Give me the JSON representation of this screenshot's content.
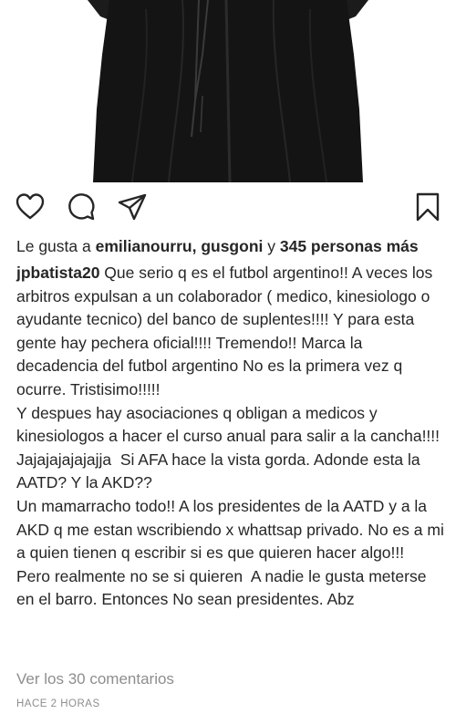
{
  "post": {
    "image_alt": "dark robe",
    "actions": {
      "like": "heart-icon",
      "comment": "comment-icon",
      "share": "share-icon",
      "save": "bookmark-icon"
    },
    "likes": {
      "prefix": "Le gusta a ",
      "users": "emilianourru, gusgoni",
      "connector": " y ",
      "others": "345 personas más"
    },
    "caption": {
      "username": "jpbatista20",
      "text": " Que serio q es el futbol argentino!! A veces los arbitros expulsan a un colaborador ( medico, kinesiologo o ayudante tecnico) del banco de suplentes!!!! Y para esta gente hay pechera oficial!!!! Tremendo!! Marca la decadencia del futbol argentino No es la primera vez q ocurre. Tristisimo!!!!!\nY despues hay asociaciones q obligan a medicos y kinesiologos a hacer el curso anual para salir a la cancha!!!! Jajajajajajajja  Si AFA hace la vista gorda. Adonde esta la AATD? Y la AKD??\nUn mamarracho todo!! A los presidentes de la AATD y a la AKD q me estan wscribiendo x whattsap privado. No es a mi a quien tienen q escribir si es que quieren hacer algo!!!\nPero realmente no se si quieren  A nadie le gusta meterse en el barro. Entonces No sean presidentes. Abz"
    },
    "comments_link": "Ver los 30 comentarios",
    "timestamp": "HACE 2 HORAS"
  }
}
